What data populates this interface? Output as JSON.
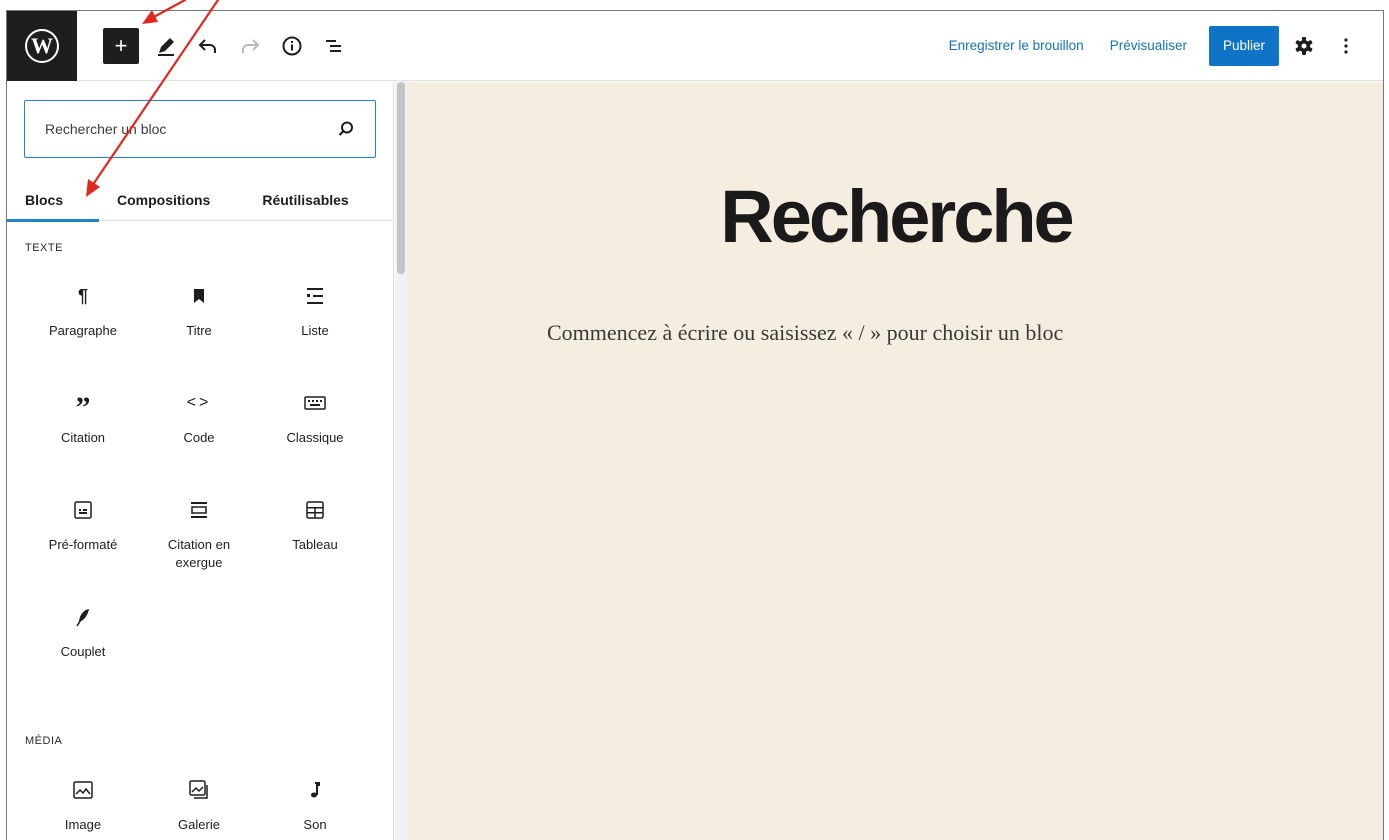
{
  "toolbar": {
    "logo_icon": "wordpress-logo-icon",
    "inserter_label": "+",
    "save_draft": "Enregistrer le brouillon",
    "preview": "Prévisualiser",
    "publish": "Publier",
    "tools": [
      "edit-pencil-icon",
      "undo-icon",
      "redo-icon",
      "info-icon",
      "list-view-icon"
    ],
    "settings_icon": "gear-icon",
    "more_icon": "more-vertical-icon",
    "publish_color": "#0f73c6",
    "link_color": "#1572b6"
  },
  "sidebar": {
    "search_placeholder": "Rechercher un bloc",
    "tabs": [
      "Blocs",
      "Compositions",
      "Réutilisables"
    ],
    "active_tab": "Blocs",
    "sections": [
      {
        "label": "TEXTE",
        "blocks": [
          {
            "label": "Paragraphe",
            "icon": "paragraph-icon"
          },
          {
            "label": "Titre",
            "icon": "heading-bookmark-icon"
          },
          {
            "label": "Liste",
            "icon": "list-icon"
          },
          {
            "label": "Citation",
            "icon": "quote-icon"
          },
          {
            "label": "Code",
            "icon": "code-icon"
          },
          {
            "label": "Classique",
            "icon": "keyboard-icon"
          },
          {
            "label": "Pré-formaté",
            "icon": "preformatted-icon"
          },
          {
            "label": "Citation en exergue",
            "icon": "pullquote-icon"
          },
          {
            "label": "Tableau",
            "icon": "table-icon"
          },
          {
            "label": "Couplet",
            "icon": "verse-feather-icon"
          }
        ]
      },
      {
        "label": "MÉDIA",
        "blocks": [
          {
            "label": "Image",
            "icon": "image-icon"
          },
          {
            "label": "Galerie",
            "icon": "gallery-icon"
          },
          {
            "label": "Son",
            "icon": "audio-note-icon"
          }
        ]
      }
    ]
  },
  "editor": {
    "title": "Recherche",
    "placeholder": "Commencez à écrire ou saisissez « / » pour choisir un bloc",
    "background": "#f4ede0"
  },
  "annotation_color": "#e0281e"
}
